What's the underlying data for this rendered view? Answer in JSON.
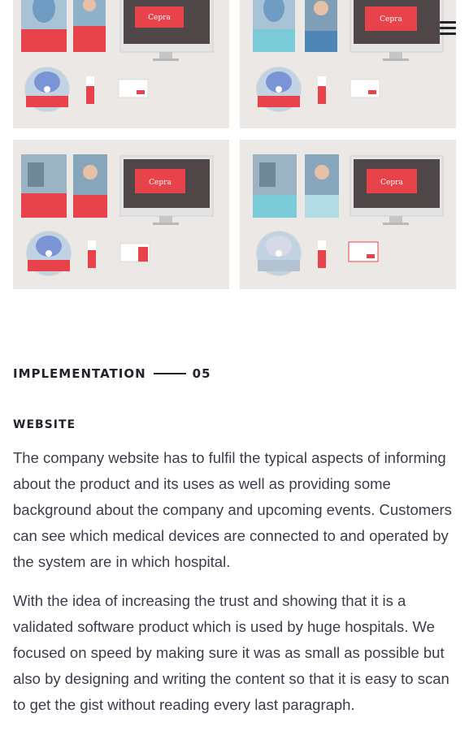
{
  "header": {
    "menu_icon": "hamburger-menu-icon"
  },
  "gallery": {
    "items": [
      {
        "brand_label": "Cepra"
      },
      {
        "brand_label": "Cepra"
      },
      {
        "brand_label": "Cepra"
      },
      {
        "brand_label": "Cepra"
      }
    ]
  },
  "section": {
    "title": "IMPLEMENTATION",
    "number": "05"
  },
  "subsection": {
    "title": "WEBSITE"
  },
  "body": {
    "paragraph_1": "The company website has to fulfil the typical aspects of informing about the product and its uses as well as providing some background about the company and upcoming events. Customers can see which medical devices are connected to and operated by the system are in which hospital.",
    "paragraph_2": "With the idea of increasing the trust and showing that it is a validated software product which is used by huge hospitals. We focused on speed by making sure it was as small as possible but also by designing and writing the content so that it is easy to scan to get the gist without reading every last paragraph."
  },
  "colors": {
    "brand_red": "#e8424a",
    "tile_background": "#ece8e6",
    "heading": "#23232b",
    "body_text": "#3d3d4a"
  }
}
